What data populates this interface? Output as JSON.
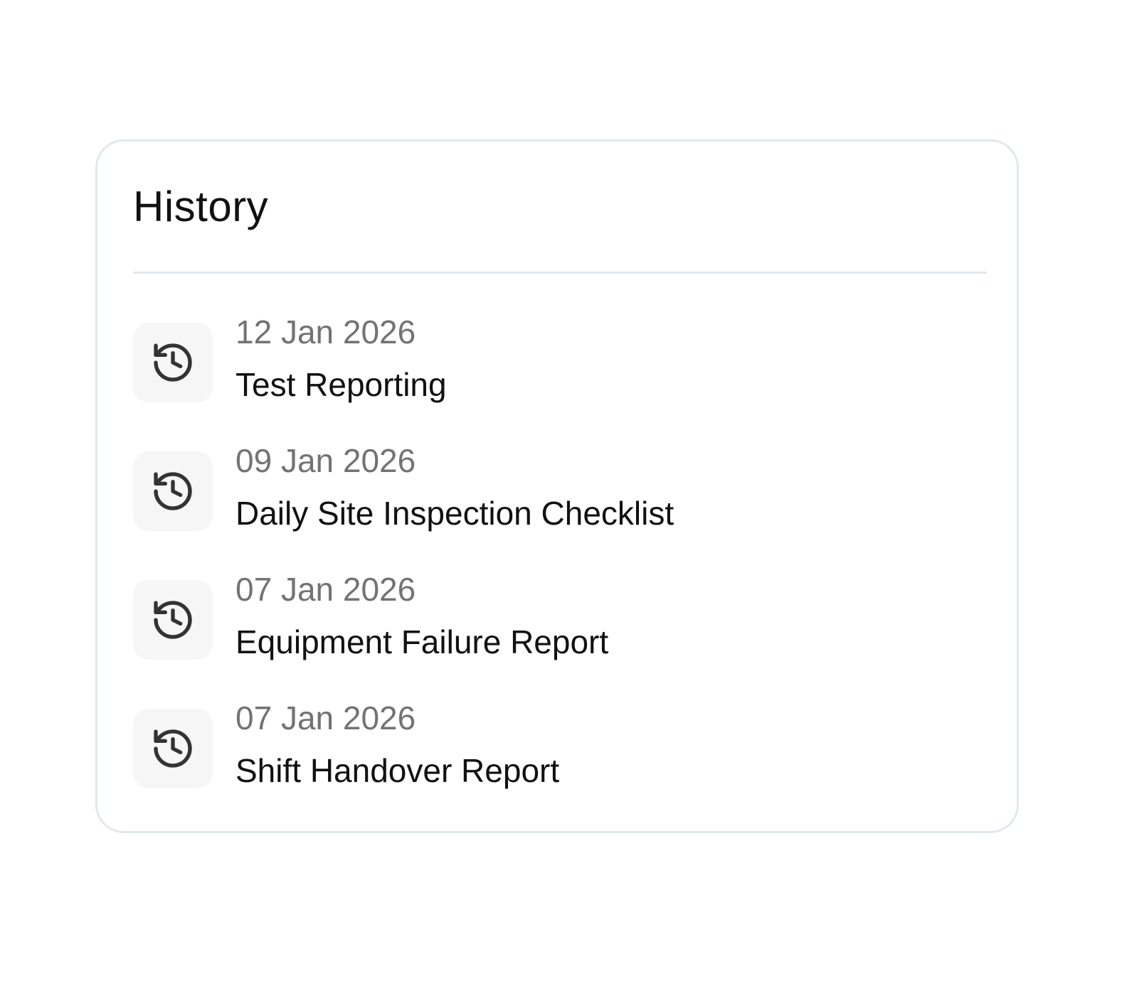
{
  "history": {
    "title": "History",
    "items": [
      {
        "date": "12 Jan 2026",
        "name": "Test Reporting",
        "icon": "history-icon"
      },
      {
        "date": "09 Jan 2026",
        "name": "Daily Site Inspection Checklist",
        "icon": "history-icon"
      },
      {
        "date": "07 Jan 2026",
        "name": "Equipment Failure Report",
        "icon": "history-icon"
      },
      {
        "date": "07 Jan 2026",
        "name": "Shift Handover Report",
        "icon": "history-icon"
      }
    ]
  },
  "colors": {
    "border": "#e2e8ee",
    "icon_bg": "#f6f6f7",
    "date_text": "#737373",
    "name_text": "#111111"
  }
}
